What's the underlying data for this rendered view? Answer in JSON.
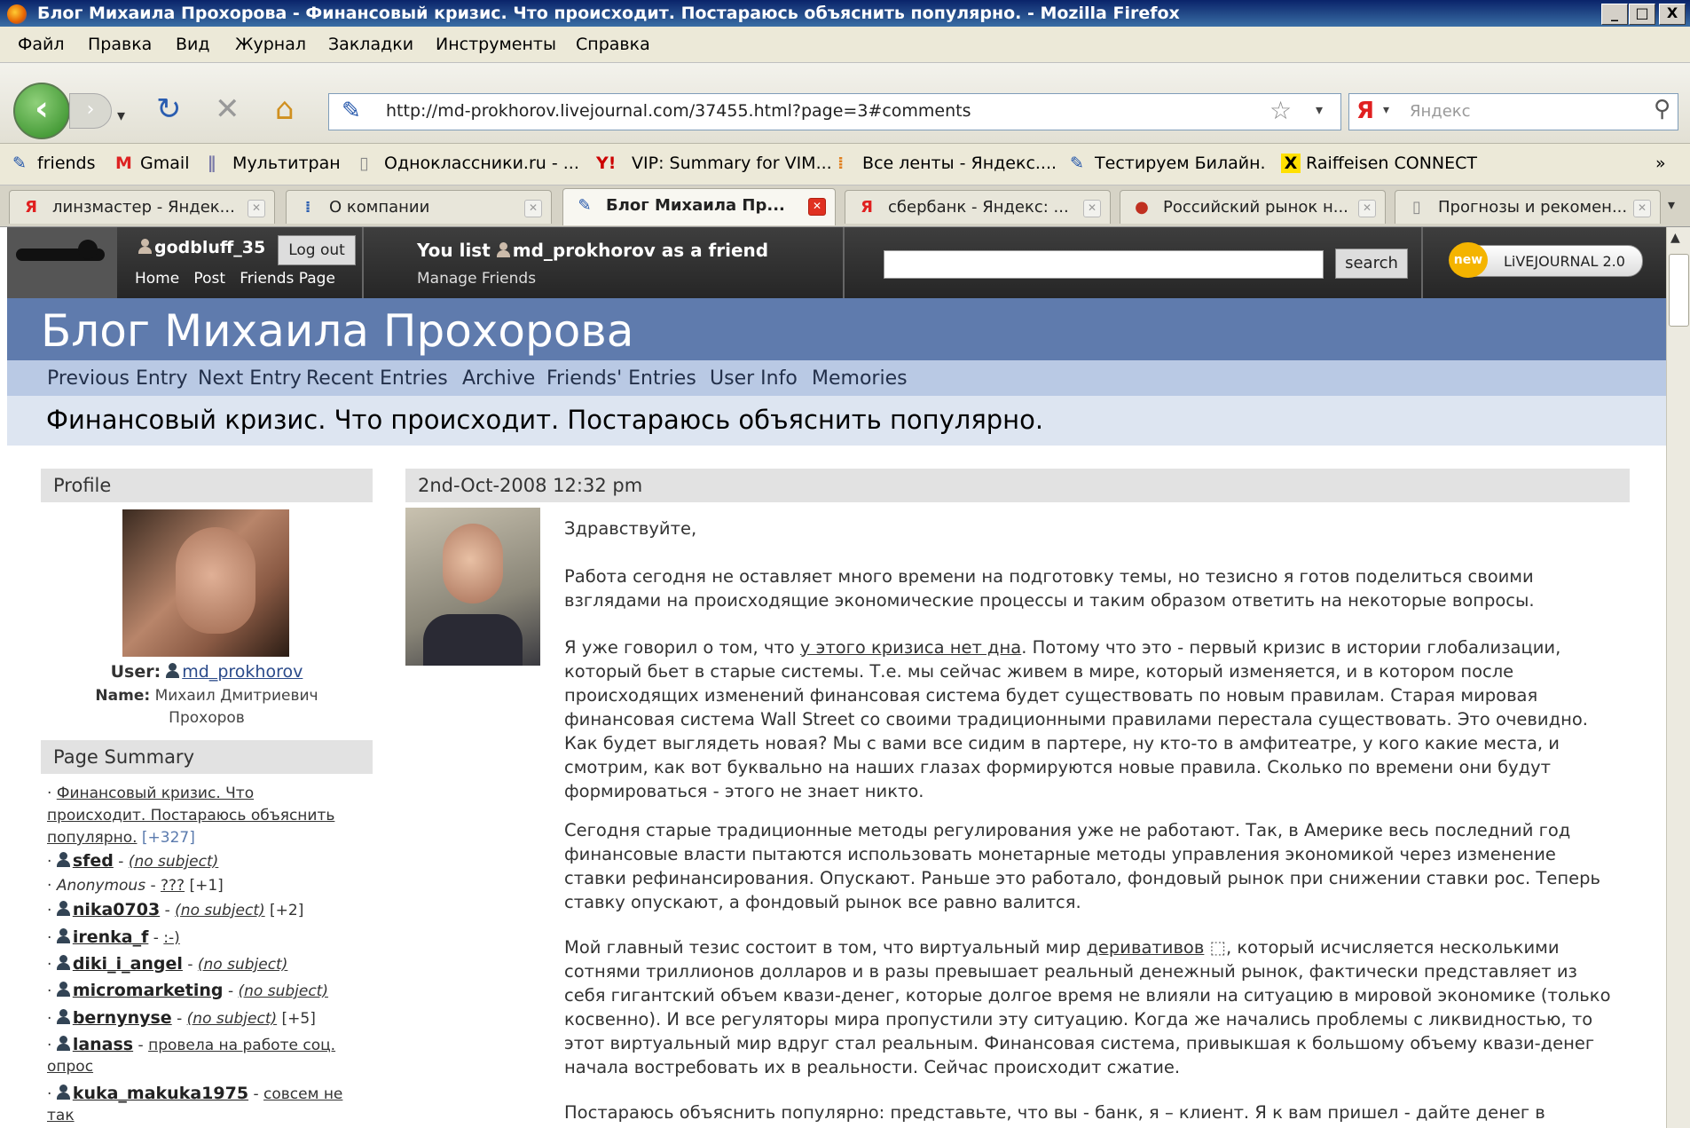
{
  "window": {
    "title": "Блог Михаила Прохорова - Финансовый кризис. Что происходит. Постараюсь объяснить популярно. - Mozilla Firefox",
    "controls": [
      "_",
      "□",
      "X"
    ]
  },
  "menu": [
    "Файл",
    "Правка",
    "Вид",
    "Журнал",
    "Закладки",
    "Инструменты",
    "Справка"
  ],
  "toolbar": {
    "url": "http://md-prokhorov.livejournal.com/37455.html?page=3#comments",
    "search_placeholder": "Яндекс",
    "search_engine": "Я"
  },
  "bookmarks": [
    {
      "icon": "✎",
      "label": "friends"
    },
    {
      "icon": "M",
      "label": "Gmail"
    },
    {
      "icon": "∥",
      "label": "Мультитран"
    },
    {
      "icon": "▯",
      "label": "Одноклассники.ru - ..."
    },
    {
      "icon": "Y!",
      "label": "VIP: Summary for VIM..."
    },
    {
      "icon": "⁞",
      "label": "Все ленты - Яндекс...."
    },
    {
      "icon": "✎",
      "label": "Тестируем Билайн."
    },
    {
      "icon": "X",
      "label": "Raiffeisen CONNECT"
    },
    {
      "icon": "»",
      "label": ""
    }
  ],
  "tabs": [
    {
      "icon": "Я",
      "label": "линзмастер - Яндек...",
      "active": false
    },
    {
      "icon": "⁞",
      "label": "О компании",
      "active": false
    },
    {
      "icon": "✎",
      "label": "Блог Михаила Пр...",
      "active": true
    },
    {
      "icon": "Я",
      "label": "сбербанк - Яндекс: ...",
      "active": false
    },
    {
      "icon": "●",
      "label": "Российский рынок н...",
      "active": false
    },
    {
      "icon": "▯",
      "label": "Прогнозы и рекомен...",
      "active": false
    }
  ],
  "lj": {
    "username": "godbluff_35",
    "logout": "Log out",
    "nav": [
      "Home",
      "Post",
      "Friends Page"
    ],
    "friend_prefix": "You list",
    "friend_user": "md_prokhorov",
    "friend_suffix": "as a friend",
    "manage": "Manage Friends",
    "search_btn": "search",
    "badge_new": "new",
    "badge": "LiVEJOURNAL 2.0"
  },
  "blog": {
    "title": "Блог Михаила Прохорова",
    "nav": [
      "Previous Entry",
      "Next Entry",
      "Recent Entries",
      "Archive",
      "Friends' Entries",
      "User Info",
      "Memories"
    ],
    "entry_title": "Финансовый кризис. Что происходит. Постараюсь объяснить популярно."
  },
  "profile": {
    "heading": "Profile",
    "user_label": "User:",
    "user": "md_prokhorov",
    "name_label": "Name:",
    "name_1": "Михаил Дмитриевич",
    "name_2": "Прохоров"
  },
  "summary": {
    "heading": "Page Summary",
    "first_1": "Финансовый кризис. Что",
    "first_2": "происходит. Постараюсь объяснить",
    "first_3": "популярно.",
    "first_count": "[+327]",
    "items": [
      {
        "user": "sfed",
        "subject": "(no subject)",
        "count": ""
      },
      {
        "user": "Anonymous",
        "subject": "???",
        "count": "[+1]"
      },
      {
        "user": "nika0703",
        "subject": "(no subject)",
        "count": "[+2]"
      },
      {
        "user": "irenka_f",
        "subject": ":-)",
        "count": ""
      },
      {
        "user": "diki_i_angel",
        "subject": "(no subject)",
        "count": ""
      },
      {
        "user": "micromarketing",
        "subject": "(no subject)",
        "count": ""
      },
      {
        "user": "bernynyse",
        "subject": "(no subject)",
        "count": "[+5]"
      },
      {
        "user": "lanass",
        "subject": "провела на работе соц.",
        "subject_2": "опрос",
        "count": ""
      },
      {
        "user": "kuka_makuka1975",
        "subject": "совсем не",
        "subject_2": "так",
        "count": ""
      }
    ]
  },
  "post": {
    "date": "2nd-Oct-2008 12:32 pm",
    "greeting": "Здравствуйте,",
    "p1": "Работа сегодня не оставляет много времени на подготовку темы, но тезисно я готов поделиться своими взглядами на происходящие экономические процессы и таким образом ответить на некоторые вопросы.",
    "p2_pre": "Я уже говорил о том, что ",
    "p2_link": "у этого кризиса нет дна",
    "p2_post": ". Потому что это - первый кризис в истории глобализации, который бьет в старые системы. Т.е. мы сейчас живем в мире, который изменяется, и в котором после происходящих изменений финансовая система будет существовать по новым правилам. Старая мировая финансовая система Wall Street  со своими традиционными правилами перестала существовать. Это очевидно. Как будет выглядеть новая? Мы с вами все сидим в партере, ну кто-то в амфитеатре, у кого какие места, и смотрим, как вот буквально на наших глазах формируются новые правила. Сколько по времени они будут формироваться - этого не знает никто.",
    "p3": "Сегодня старые традиционные методы регулирования уже не работают. Так, в Америке весь последний год финансовые власти пытаются использовать монетарные методы управления экономикой через изменение ставки рефинансирования. Опускают. Раньше это работало, фондовый рынок при снижении ставки рос. Теперь ставку опускают, а фондовый рынок все равно валится.",
    "p4_pre": "Мой главный тезис состоит в том, что виртуальный мир ",
    "p4_link": "деривативов",
    "p4_post": ", который исчисляется несколькими сотнями триллионов долларов и в разы превышает реальный денежный рынок, фактически представляет из себя гигантский объем квази-денег, которые долгое время не влияли на ситуацию в мировой экономике (только косвенно). И все регуляторы мира пропустили эту ситуацию.  Когда же начались проблемы с ликвидностью, то этот виртуальный мир вдруг стал реальным. Финансовая система, привыкшая к большому объему квази-денег начала востребовать их в реальности. Сейчас происходит сжатие.",
    "p5": "Постараюсь объяснить популярно:   представьте, что вы - банк, я – клиент. Я к вам пришел - дайте денег в"
  }
}
